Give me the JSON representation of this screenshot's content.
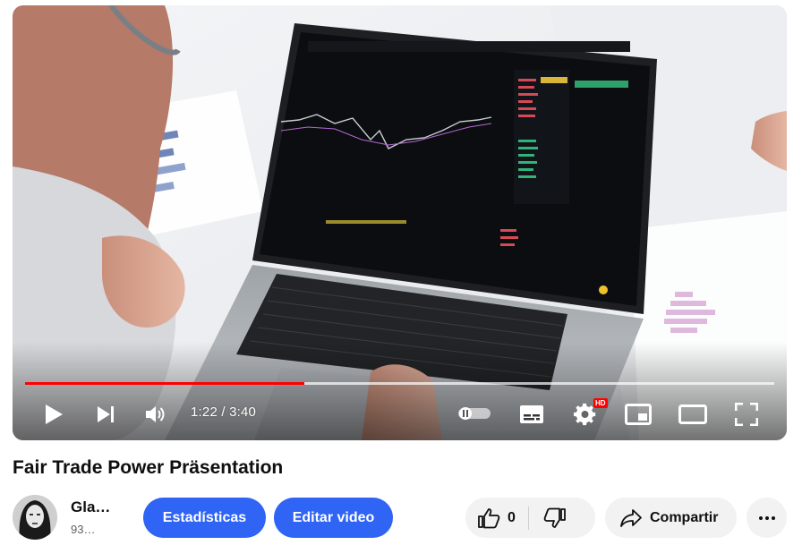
{
  "player": {
    "current_time": "1:22",
    "duration": "3:40",
    "time_display": "1:22 / 3:40",
    "played_fraction": 0.3727,
    "loaded_fraction": 1.0,
    "hd_badge": "HD",
    "accent_color": "#ff0000",
    "icons": [
      "play-icon",
      "next-icon",
      "volume-icon",
      "autoplay-toggle-icon",
      "subtitles-icon",
      "settings-icon",
      "miniplayer-icon",
      "theater-mode-icon",
      "fullscreen-icon"
    ]
  },
  "video": {
    "title": "Fair Trade Power Präsentation"
  },
  "channel": {
    "name": "Gla…",
    "subscribers": "93…"
  },
  "actions": {
    "stats_label": "Estadísticas",
    "edit_label": "Editar video",
    "like_count": "0",
    "share_label": "Compartir",
    "button_color": "#2f64f5"
  }
}
